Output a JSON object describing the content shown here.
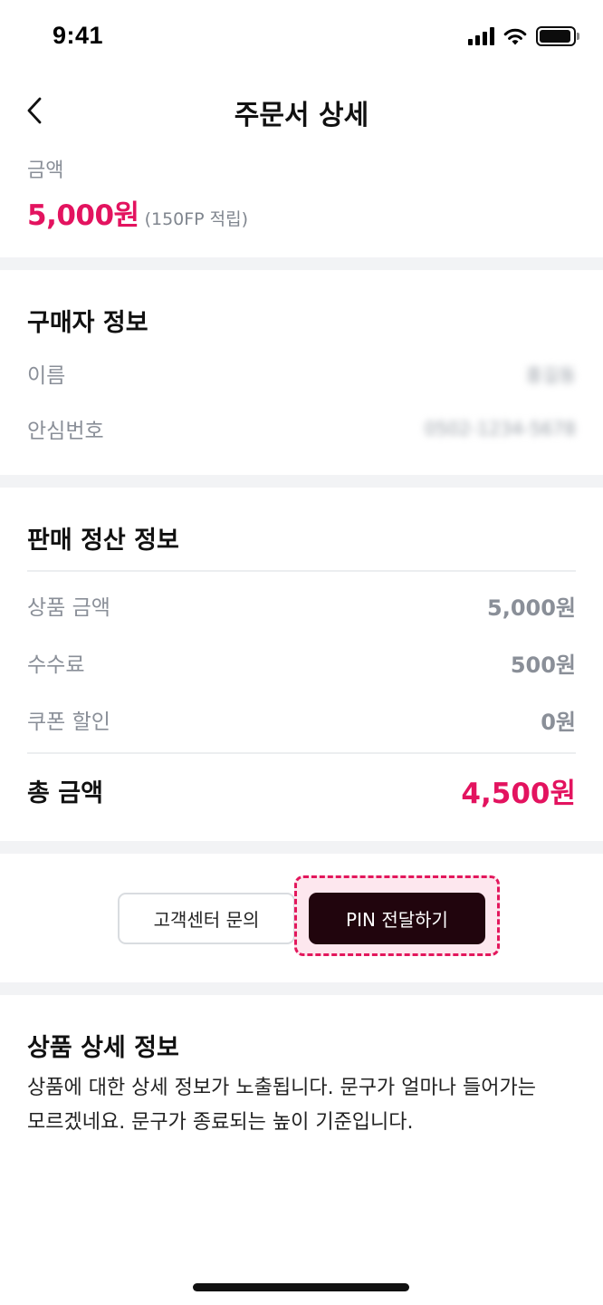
{
  "status_bar": {
    "time": "9:41"
  },
  "header": {
    "title": "주문서 상세"
  },
  "amount": {
    "label": "금액",
    "value": "5,000원",
    "note": "(150FP 적립)"
  },
  "buyer": {
    "title": "구매자 정보",
    "name_label": "이름",
    "name_value": "홍길동",
    "phone_label": "안심번호",
    "phone_value": "0502-1234-5678"
  },
  "settlement": {
    "title": "판매 정산 정보",
    "rows": [
      {
        "label": "상품 금액",
        "value": "5,000원"
      },
      {
        "label": "수수료",
        "value": "500원"
      },
      {
        "label": "쿠폰 할인",
        "value": "0원"
      }
    ],
    "total_label": "총 금액",
    "total_value": "4,500원"
  },
  "actions": {
    "support_label": "고객센터 문의",
    "pin_label": "PIN 전달하기"
  },
  "product": {
    "title": "상품 상세 정보",
    "description": "상품에 대한 상세 정보가 노출됩니다. 문구가 얼마나 들어가는 모르겠네요. 문구가 종료되는 높이 기준입니다."
  },
  "colors": {
    "accent": "#e3135f",
    "primary_button": "#21050d",
    "highlight": "#fde7ee",
    "divider": "#f2f3f5"
  },
  "icons": {
    "back": "chevron-left-icon",
    "signal": "cellular-signal-icon",
    "wifi": "wifi-icon",
    "battery": "battery-icon"
  }
}
